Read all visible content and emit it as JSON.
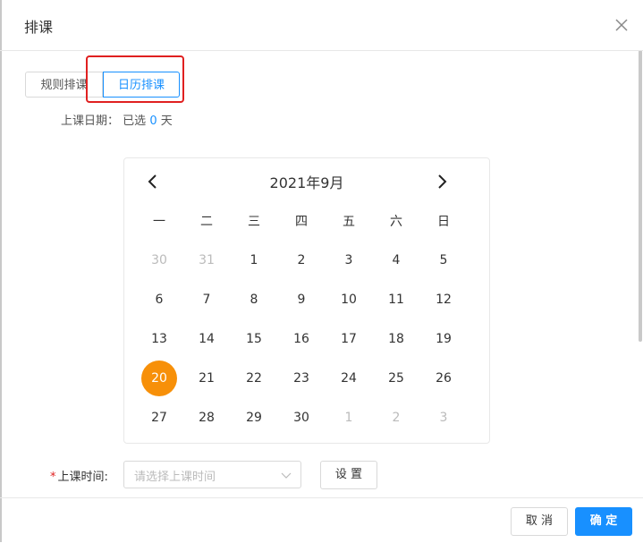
{
  "dialog": {
    "title": "排课",
    "close_icon": "close-icon"
  },
  "tabs": [
    {
      "label": "规则排课"
    },
    {
      "label": "日历排课"
    }
  ],
  "active_tab": "日历排课",
  "date_summary": {
    "label": "上课日期：",
    "prefix": "已选",
    "count": "0",
    "suffix": "天"
  },
  "calendar": {
    "title": "2021年9月",
    "weekdays": [
      "一",
      "二",
      "三",
      "四",
      "五",
      "六",
      "日"
    ],
    "days": [
      [
        "30",
        "31",
        "1",
        "2",
        "3",
        "4",
        "5"
      ],
      [
        "6",
        "7",
        "8",
        "9",
        "10",
        "11",
        "12"
      ],
      [
        "13",
        "14",
        "15",
        "16",
        "17",
        "18",
        "19"
      ],
      [
        "20",
        "21",
        "22",
        "23",
        "24",
        "25",
        "26"
      ],
      [
        "27",
        "28",
        "29",
        "30",
        "1",
        "2",
        "3"
      ]
    ],
    "selected_day": "20",
    "selected_color": "#f79009"
  },
  "time": {
    "required_mark": "*",
    "label": "上课时间:",
    "placeholder": "请选择上课时间",
    "settings_label": "设 置"
  },
  "footer": {
    "cancel_label": "取 消",
    "confirm_label": "确 定"
  },
  "colors": {
    "primary": "#1890ff",
    "highlight_box": "#e02020"
  }
}
